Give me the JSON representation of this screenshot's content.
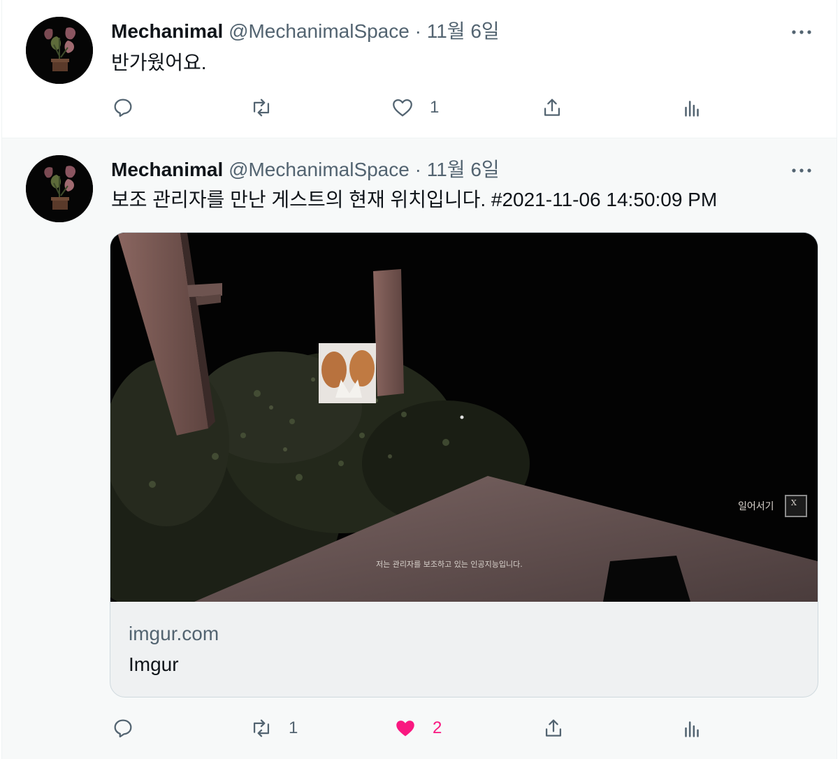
{
  "tweets": [
    {
      "name": "Mechanimal",
      "handle": "@MechanimalSpace",
      "separator": "·",
      "date": "11월 6일",
      "text": "반가웠어요.",
      "actions": {
        "reply_count": "",
        "retweet_count": "",
        "like_count": "1",
        "liked": false
      }
    },
    {
      "name": "Mechanimal",
      "handle": "@MechanimalSpace",
      "separator": "·",
      "date": "11월 6일",
      "text": "보조 관리자를 만난 게스트의 현재 위치입니다. #2021-11-06 14:50:09 PM",
      "card": {
        "domain": "imgur.com",
        "title": "Imgur",
        "media": {
          "overlay_button_label": "일어서기",
          "overlay_close": "X",
          "caption": "저는 관리자를 보조하고 있는 인공지능입니다."
        }
      },
      "actions": {
        "reply_count": "",
        "retweet_count": "1",
        "like_count": "2",
        "liked": true
      }
    }
  ],
  "colors": {
    "text_primary": "#0f1419",
    "text_secondary": "#536471",
    "like_active": "#f91880",
    "background_hover": "#f7f9f9"
  },
  "icons": [
    "avatar-plant",
    "more-icon",
    "reply-icon",
    "retweet-icon",
    "like-icon",
    "share-icon",
    "analytics-icon"
  ]
}
